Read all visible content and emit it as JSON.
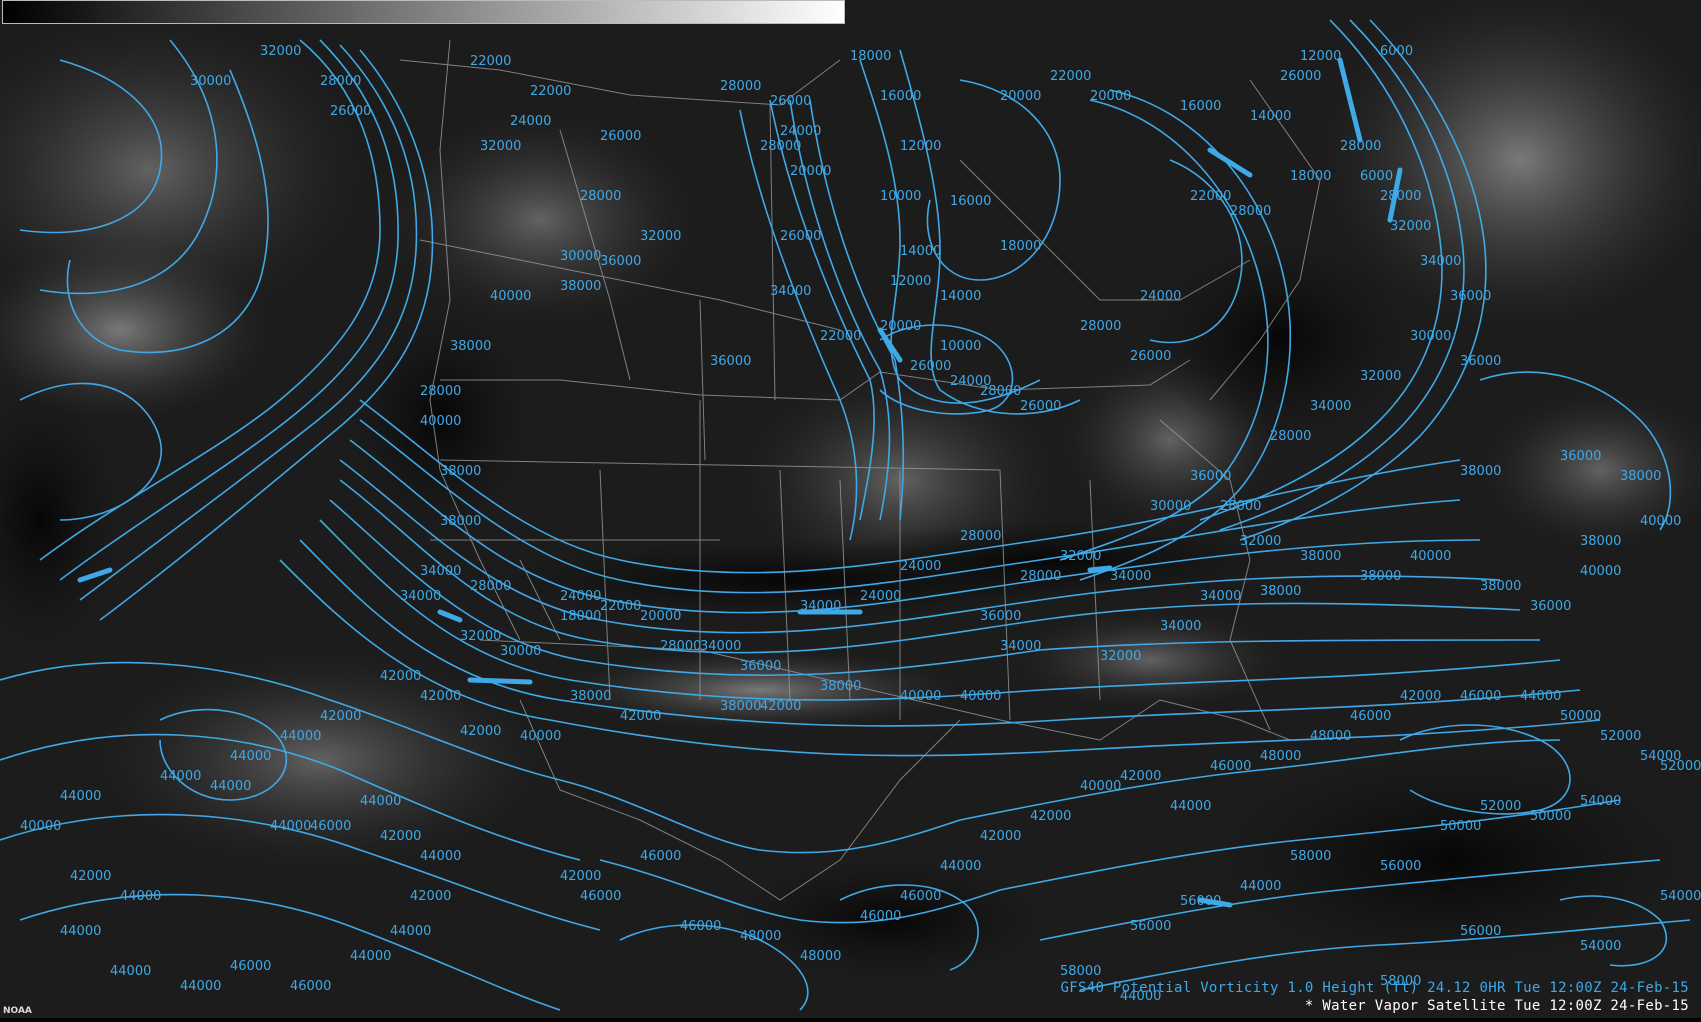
{
  "colors": {
    "contour": "#3fa9e8",
    "background": "#1c1c1c",
    "borders": "#9a9a9a",
    "caption_secondary": "#ffffff"
  },
  "captions": {
    "product": "GFS40 Potential Vorticity 1.0 Height (ft)   24.12   0HR Tue 12:00Z 24-Feb-15",
    "satellite": "* Water Vapor Satellite   Tue 12:00Z 24-Feb-15"
  },
  "logo": "NOAA",
  "colorbar": {
    "from": "#000000",
    "to": "#ffffff"
  },
  "contour_labels": [
    "30000",
    "28000",
    "26000",
    "24000",
    "22000",
    "20000",
    "18000",
    "16000",
    "14000",
    "12000",
    "10000",
    "6000",
    "32000",
    "34000",
    "36000",
    "38000",
    "40000",
    "42000",
    "44000",
    "46000",
    "48000",
    "50000",
    "52000",
    "54000",
    "56000",
    "58000"
  ]
}
